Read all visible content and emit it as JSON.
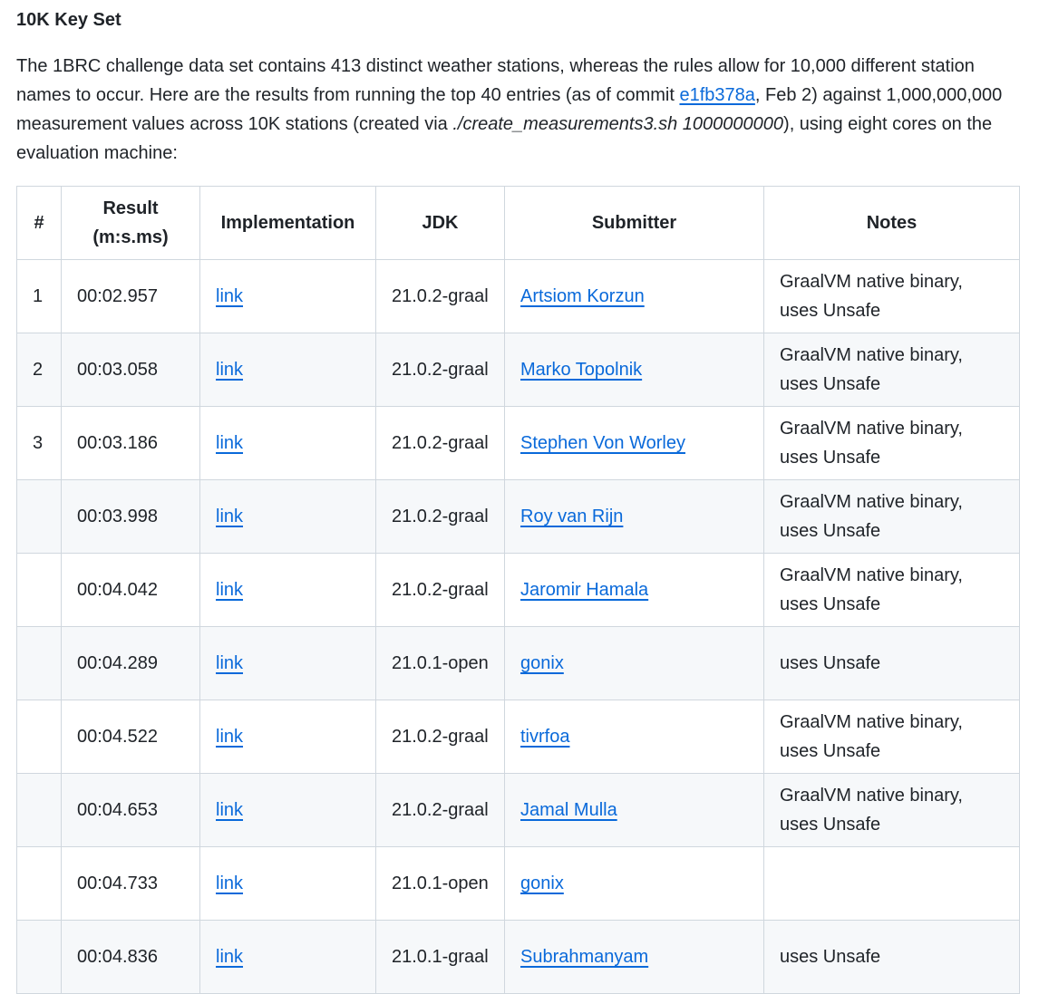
{
  "section": {
    "title": "10K Key Set"
  },
  "intro": {
    "text_1": "The 1BRC challenge data set contains 413 distinct weather stations, whereas the rules allow for 10,000 different station names to occur. Here are the results from running the top 40 entries (as of commit ",
    "commit_link": "e1fb378a",
    "text_2": ", Feb 2) against 1,000,000,000 measurement values across 10K stations (created via ",
    "command": "./create_measurements3.sh 1000000000",
    "text_3": "), using eight cores on the evaluation machine:"
  },
  "table": {
    "headers": {
      "rank": "#",
      "result": "Result (m:s.ms)",
      "implementation": "Implementation",
      "jdk": "JDK",
      "submitter": "Submitter",
      "notes": "Notes"
    },
    "rows": [
      {
        "rank": "1",
        "result": "00:02.957",
        "impl": "link",
        "jdk": "21.0.2-graal",
        "submitter": "Artsiom Korzun",
        "notes": "GraalVM native binary, uses Unsafe"
      },
      {
        "rank": "2",
        "result": "00:03.058",
        "impl": "link",
        "jdk": "21.0.2-graal",
        "submitter": "Marko Topolnik",
        "notes": "GraalVM native binary, uses Unsafe"
      },
      {
        "rank": "3",
        "result": "00:03.186",
        "impl": "link",
        "jdk": "21.0.2-graal",
        "submitter": "Stephen Von Worley",
        "notes": "GraalVM native binary, uses Unsafe"
      },
      {
        "rank": "",
        "result": "00:03.998",
        "impl": "link",
        "jdk": "21.0.2-graal",
        "submitter": "Roy van Rijn",
        "notes": "GraalVM native binary, uses Unsafe"
      },
      {
        "rank": "",
        "result": "00:04.042",
        "impl": "link",
        "jdk": "21.0.2-graal",
        "submitter": "Jaromir Hamala",
        "notes": "GraalVM native binary, uses Unsafe"
      },
      {
        "rank": "",
        "result": "00:04.289",
        "impl": "link",
        "jdk": "21.0.1-open",
        "submitter": "gonix",
        "notes": "uses Unsafe"
      },
      {
        "rank": "",
        "result": "00:04.522",
        "impl": "link",
        "jdk": "21.0.2-graal",
        "submitter": "tivrfoa",
        "notes": "GraalVM native binary, uses Unsafe"
      },
      {
        "rank": "",
        "result": "00:04.653",
        "impl": "link",
        "jdk": "21.0.2-graal",
        "submitter": "Jamal Mulla",
        "notes": "GraalVM native binary, uses Unsafe"
      },
      {
        "rank": "",
        "result": "00:04.733",
        "impl": "link",
        "jdk": "21.0.1-open",
        "submitter": "gonix",
        "notes": ""
      },
      {
        "rank": "",
        "result": "00:04.836",
        "impl": "link",
        "jdk": "21.0.1-graal",
        "submitter": "Subrahmanyam",
        "notes": "uses Unsafe"
      }
    ]
  },
  "colors": {
    "link": "#0969da",
    "text": "#1f2328",
    "border": "#d0d7de",
    "row_alt": "#f6f8fa"
  }
}
